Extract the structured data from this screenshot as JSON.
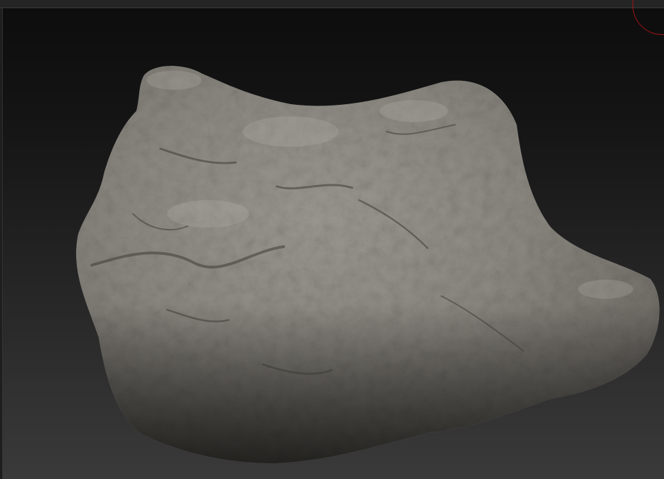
{
  "app": {
    "mode": "3d-sculpt-viewport"
  },
  "viewport": {
    "background_top": "#0d0d0d",
    "background_bottom": "#3a3a3a",
    "object": "rock-mesh",
    "material_color": "#8a8780"
  },
  "gizmo": {
    "icon": "navigation-gizmo-icon",
    "color": "#a31616"
  }
}
